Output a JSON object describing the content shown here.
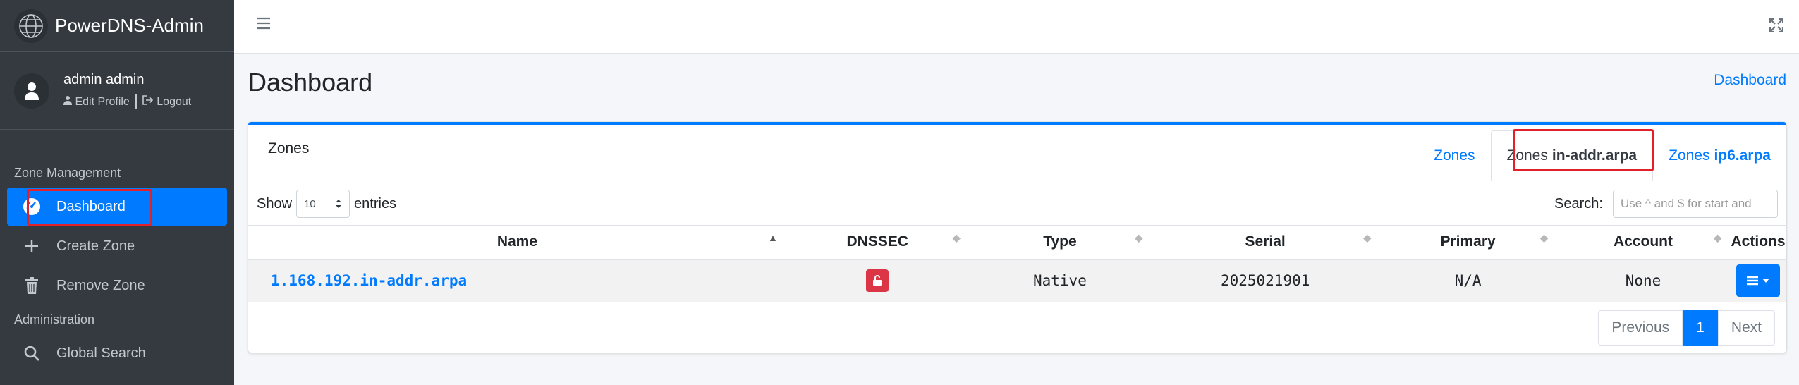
{
  "app": {
    "brand": "PowerDNS-Admin"
  },
  "user": {
    "name": "admin admin",
    "edit_profile": "Edit Profile",
    "logout": "Logout"
  },
  "sidebar": {
    "sections": [
      {
        "header": "Zone Management",
        "items": [
          {
            "label": "Dashboard",
            "icon": "dashboard-icon",
            "active": true
          },
          {
            "label": "Create Zone",
            "icon": "plus-icon"
          },
          {
            "label": "Remove Zone",
            "icon": "trash-icon"
          }
        ]
      },
      {
        "header": "Administration",
        "items": [
          {
            "label": "Global Search",
            "icon": "search-icon"
          }
        ]
      }
    ]
  },
  "page": {
    "title": "Dashboard",
    "breadcrumb": "Dashboard"
  },
  "card": {
    "title": "Zones",
    "tabs": [
      {
        "prefix": "Zones",
        "suffix": ""
      },
      {
        "prefix": "Zones",
        "suffix": "in-addr.arpa",
        "active": true
      },
      {
        "prefix": "Zones",
        "suffix": "ip6.arpa"
      }
    ]
  },
  "table_controls": {
    "show_label": "Show",
    "entries_value": "10",
    "entries_label": "entries",
    "search_label": "Search:",
    "search_placeholder": "Use ^ and $ for start and"
  },
  "table": {
    "columns": [
      "Name",
      "DNSSEC",
      "Type",
      "Serial",
      "Primary",
      "Account",
      "Actions"
    ],
    "rows": [
      {
        "name": "1.168.192.in-addr.arpa",
        "dnssec": "unlocked",
        "type": "Native",
        "serial": "2025021901",
        "primary": "N/A",
        "account": "None"
      }
    ]
  },
  "pagination": {
    "previous": "Previous",
    "current": "1",
    "next": "Next"
  },
  "colors": {
    "accent": "#007bff",
    "sidebar": "#343a40",
    "danger": "#dc3545",
    "highlight": "#e2202a"
  }
}
